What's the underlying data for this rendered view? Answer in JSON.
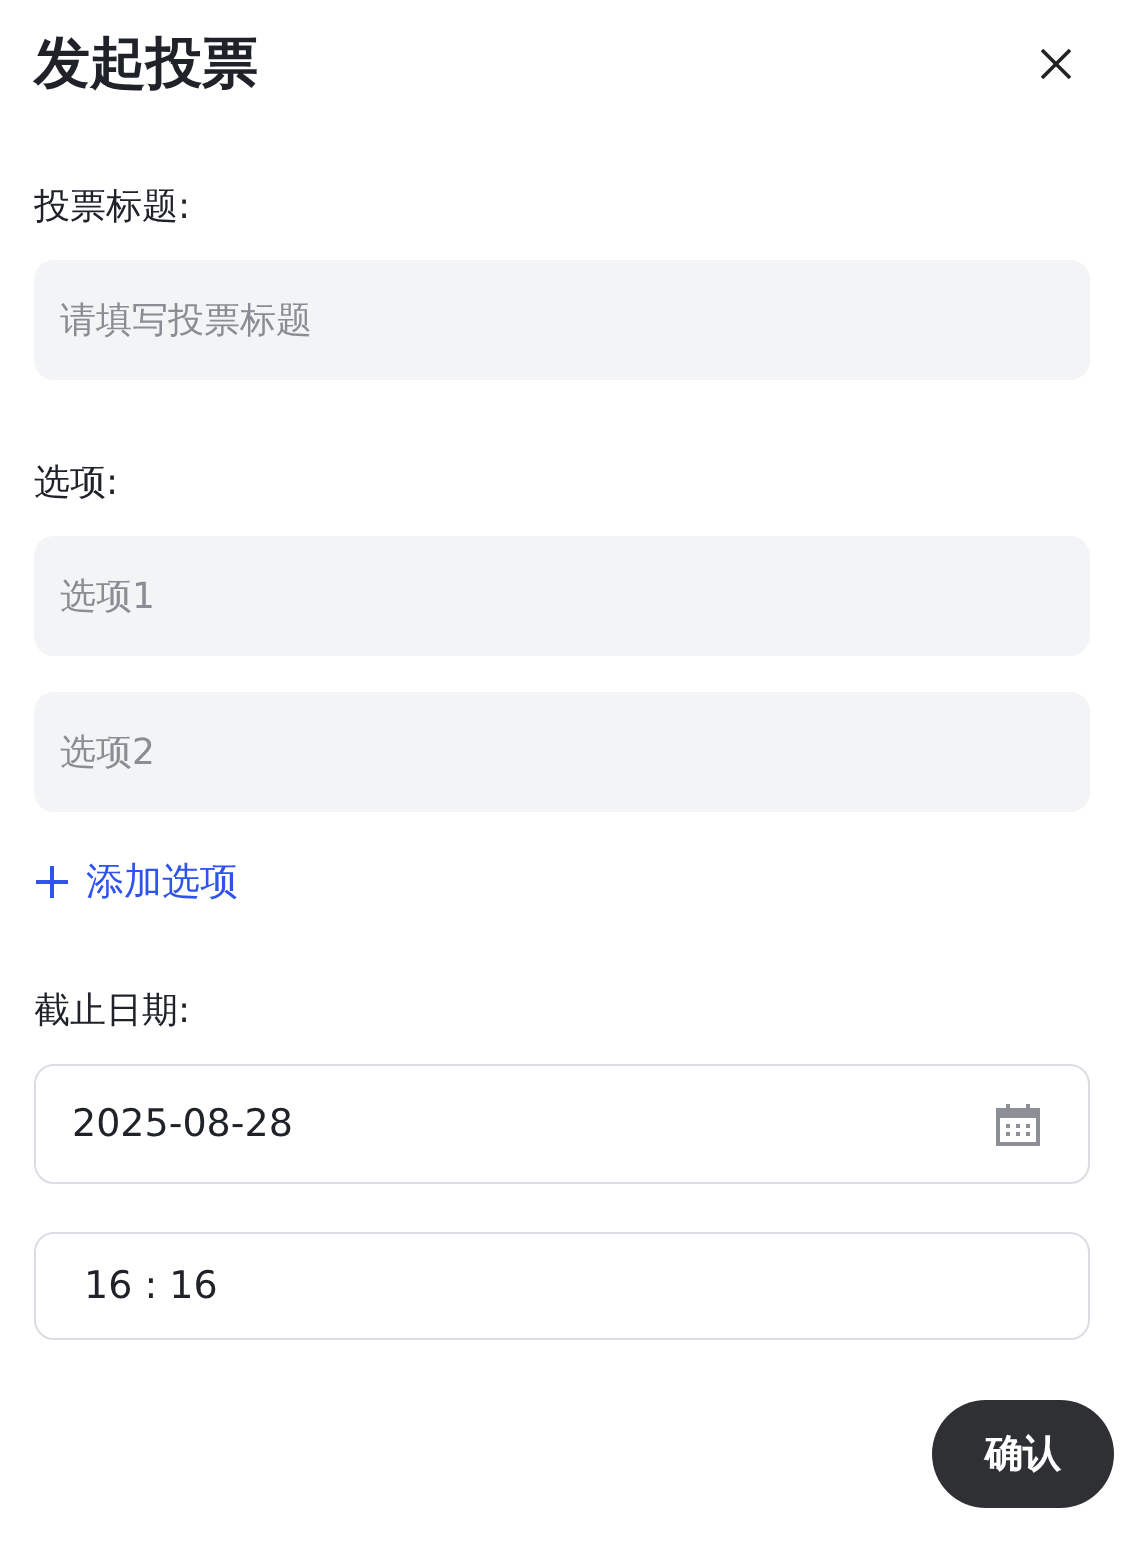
{
  "dialog": {
    "title": "发起投票"
  },
  "title_field": {
    "label": "投票标题:",
    "placeholder": "请填写投票标题"
  },
  "options": {
    "label": "选项:",
    "items": [
      {
        "placeholder": "选项1"
      },
      {
        "placeholder": "选项2"
      }
    ],
    "add_label": "添加选项"
  },
  "deadline": {
    "label": "截止日期:",
    "date": "2025-08-28",
    "time": "16 : 16"
  },
  "confirm_button": "确认"
}
